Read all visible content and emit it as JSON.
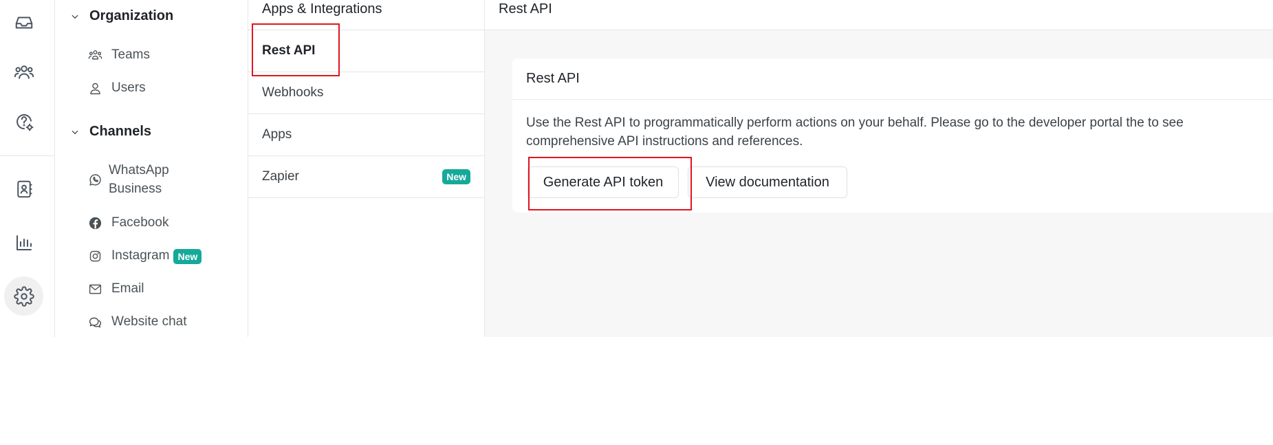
{
  "rail": {
    "items": [
      {
        "icon": "inbox-icon"
      },
      {
        "icon": "contacts-group-icon"
      },
      {
        "icon": "help-settings-icon"
      },
      {
        "icon": "contact-book-icon"
      },
      {
        "icon": "reports-chart-icon"
      },
      {
        "icon": "gear-icon",
        "active": true
      }
    ]
  },
  "nav": {
    "organization": {
      "label": "Organization",
      "items": [
        {
          "label": "Teams",
          "icon": "teams-icon"
        },
        {
          "label": "Users",
          "icon": "user-icon"
        }
      ]
    },
    "channels": {
      "label": "Channels",
      "items": [
        {
          "label": "WhatsApp Business",
          "line1": "WhatsApp",
          "line2": "Business",
          "icon": "whatsapp-icon"
        },
        {
          "label": "Facebook",
          "icon": "facebook-icon"
        },
        {
          "label": "Instagram",
          "icon": "instagram-icon",
          "badge": "New"
        },
        {
          "label": "Email",
          "icon": "mail-icon"
        },
        {
          "label": "Website chat",
          "icon": "chat-icon"
        }
      ]
    }
  },
  "subnav": {
    "title": "Apps & Integrations",
    "items": [
      {
        "label": "Rest API",
        "active": true
      },
      {
        "label": "Webhooks"
      },
      {
        "label": "Apps"
      },
      {
        "label": "Zapier",
        "badge": "New"
      }
    ]
  },
  "main": {
    "header": "Rest API",
    "card": {
      "title": "Rest API",
      "description": "Use the Rest API to programmatically perform actions on your behalf. Please go to the developer portal the to see comprehensive API instructions and references.",
      "generate_button": "Generate API token",
      "docs_button": "View documentation"
    }
  },
  "colors": {
    "accent_badge": "#16a99a",
    "highlight": "#e0141f",
    "main_bg": "#f7f7f7"
  }
}
